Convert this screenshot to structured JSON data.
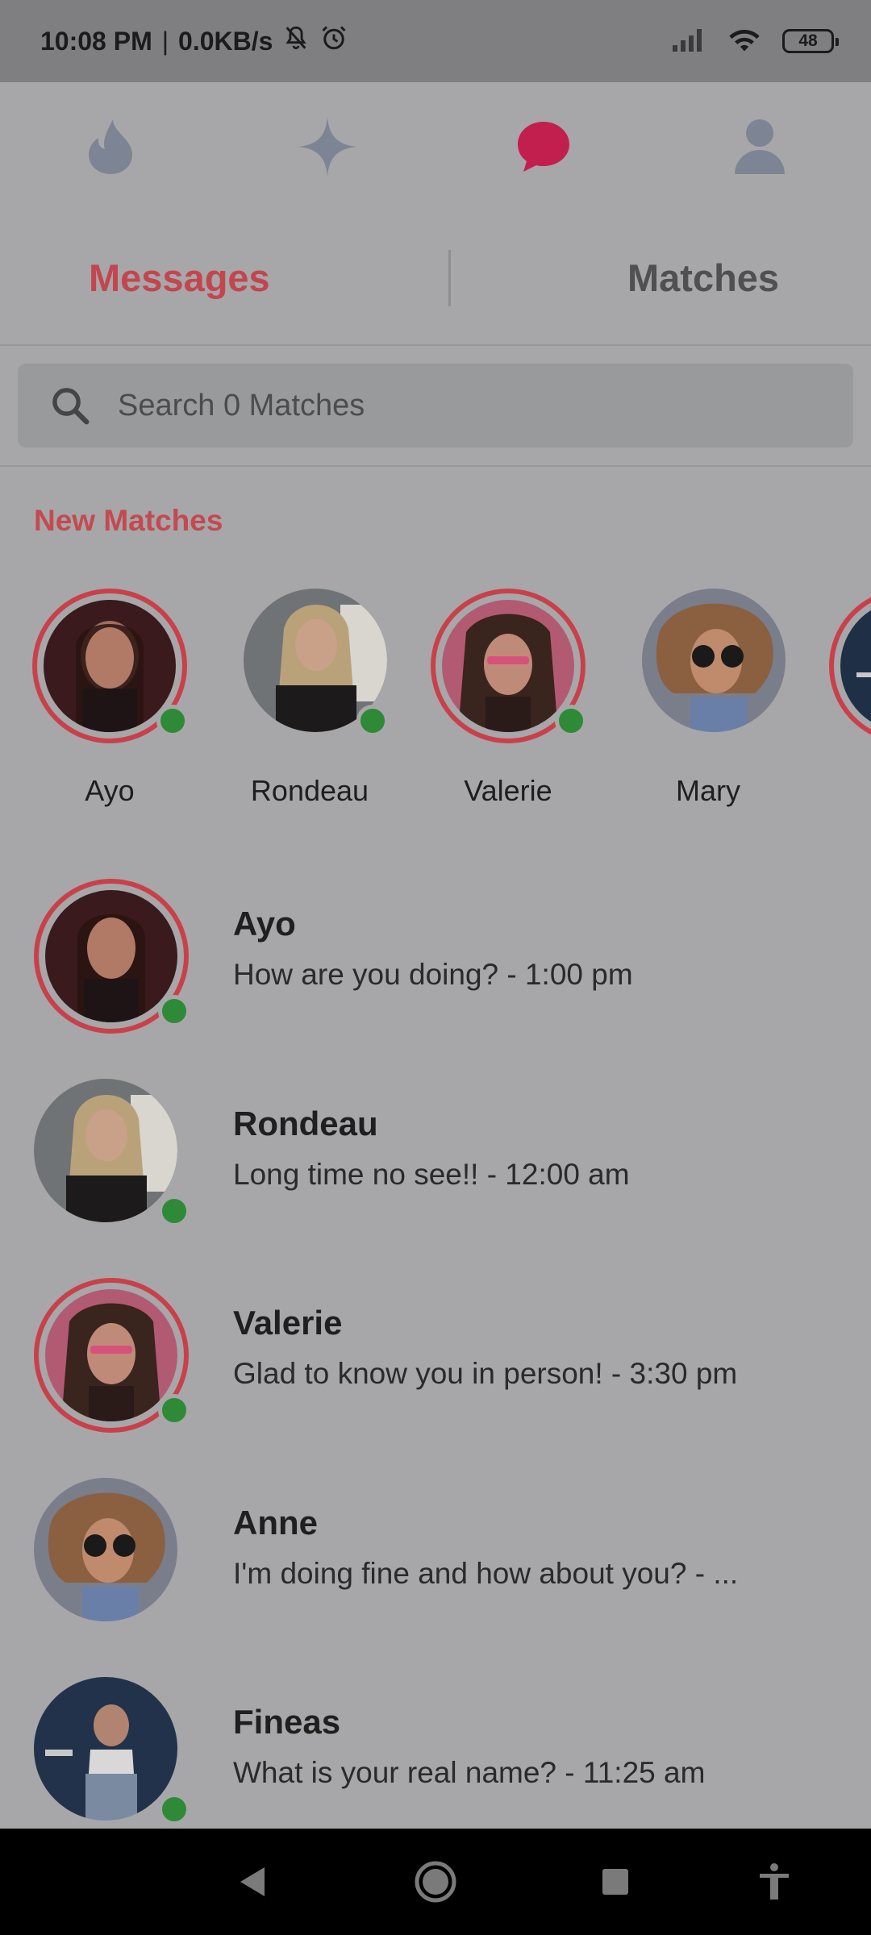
{
  "status_bar": {
    "time": "10:08 PM",
    "separator": "|",
    "network_speed": "0.0KB/s",
    "battery": "48"
  },
  "nav": {
    "items": [
      {
        "name": "flame-icon",
        "active": false
      },
      {
        "name": "sparkle-icon",
        "active": false
      },
      {
        "name": "chat-icon",
        "active": true
      },
      {
        "name": "profile-icon",
        "active": false
      }
    ],
    "active_color": "#c21f4f",
    "inactive_color": "#7d8595"
  },
  "tabs": {
    "messages": "Messages",
    "matches": "Matches",
    "active_color": "#c3464e",
    "inactive_color": "#505052"
  },
  "search": {
    "placeholder": "Search 0 Matches"
  },
  "new_matches": {
    "title": "New Matches",
    "items": [
      {
        "name": "Ayo",
        "ring": true,
        "online": true
      },
      {
        "name": "Rondeau",
        "ring": false,
        "online": true
      },
      {
        "name": "Valerie",
        "ring": true,
        "online": true
      },
      {
        "name": "Mary",
        "ring": false,
        "online": false
      }
    ]
  },
  "conversations": [
    {
      "name": "Ayo",
      "message": "How are you doing? - 1:00 pm",
      "ring": true,
      "online": true
    },
    {
      "name": "Rondeau",
      "message": "Long time no see!! - 12:00 am",
      "ring": false,
      "online": true
    },
    {
      "name": "Valerie",
      "message": "Glad to know you in person! - 3:30 pm",
      "ring": true,
      "online": true
    },
    {
      "name": "Anne",
      "message": "I'm doing fine and how about you? - ...",
      "ring": false,
      "online": false
    },
    {
      "name": "Fineas",
      "message": "What is your real name? - 11:25 am",
      "ring": false,
      "online": true
    }
  ],
  "system_nav": {
    "items": [
      "back-icon",
      "home-icon",
      "recents-icon",
      "accessibility-icon"
    ]
  }
}
